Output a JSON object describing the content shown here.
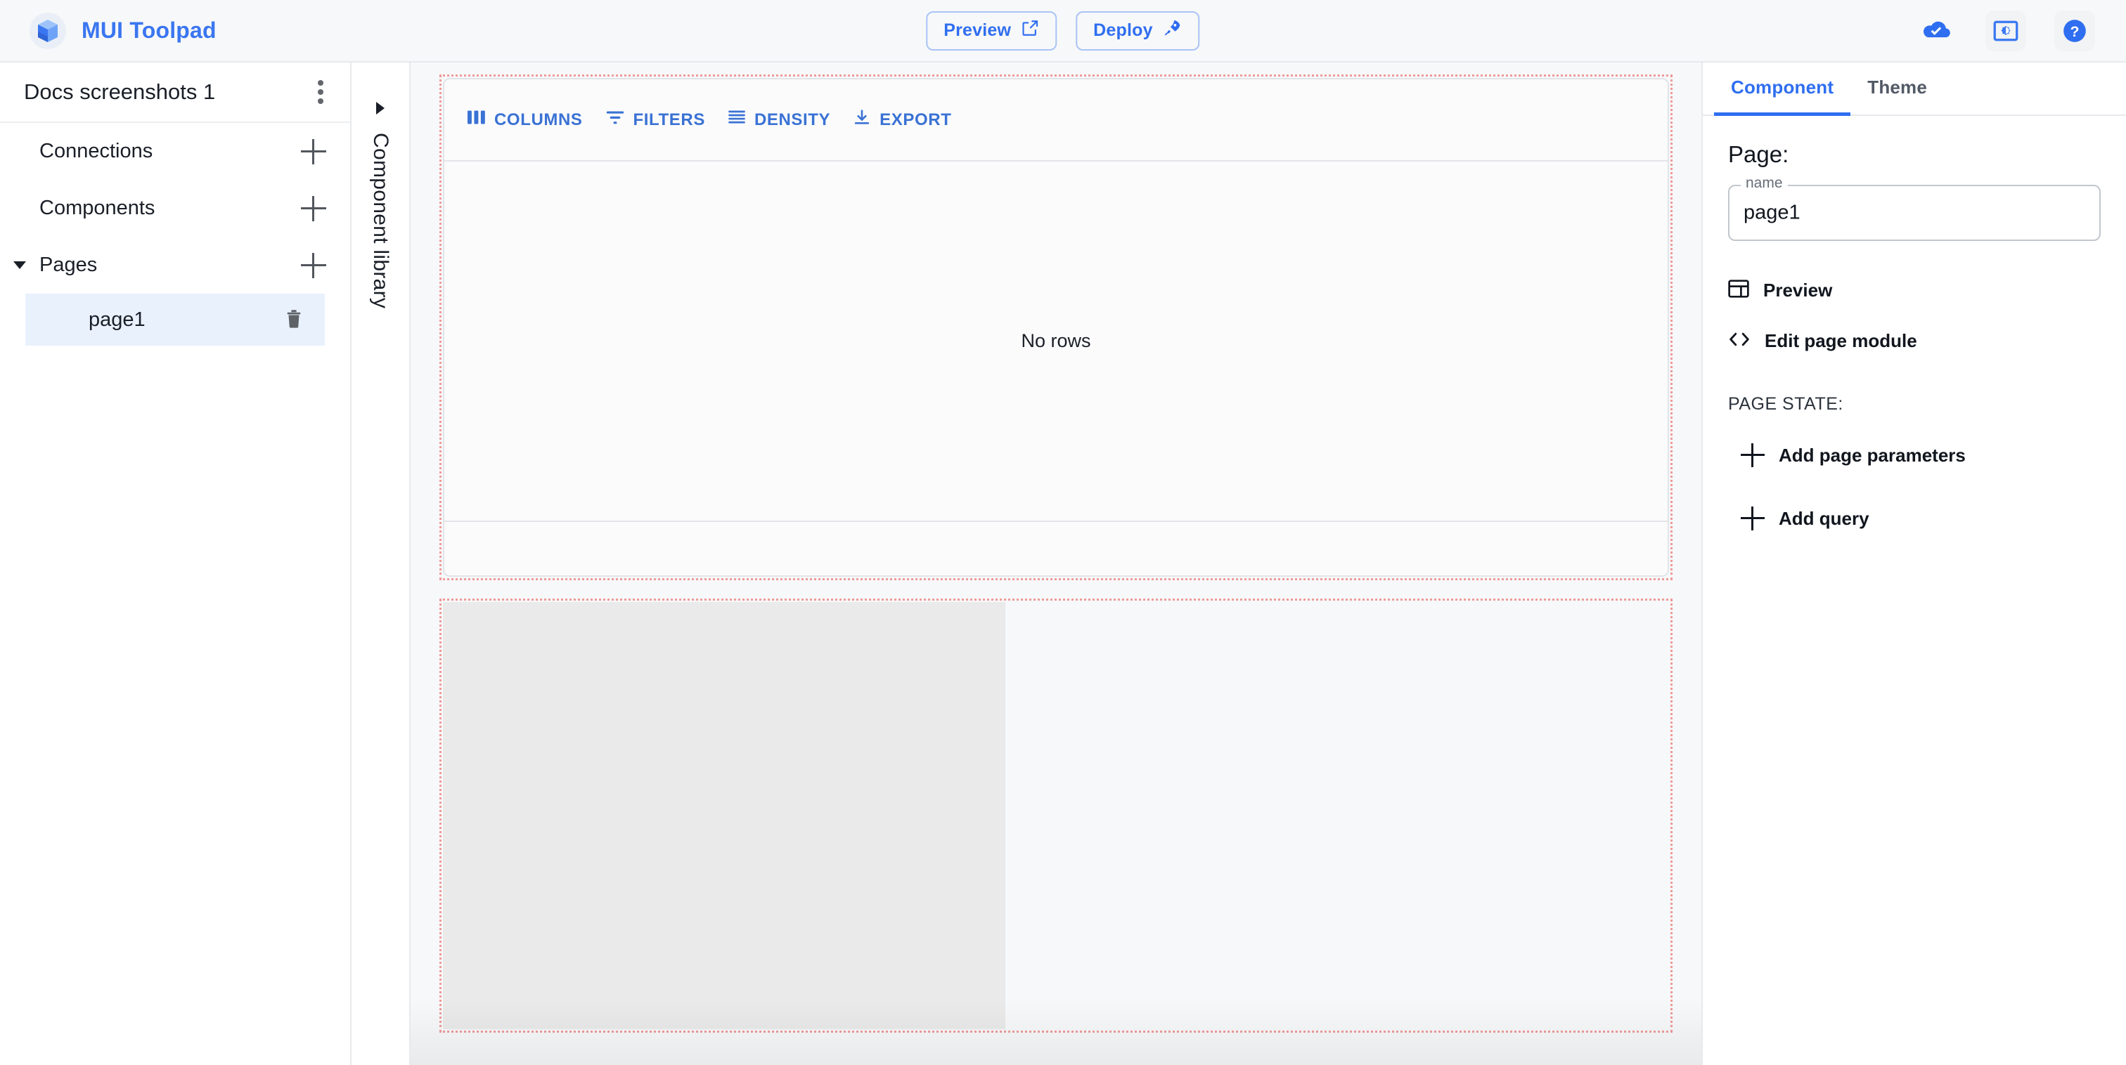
{
  "header": {
    "brand_title": "MUI Toolpad",
    "logo_icon": "toolpad-logo-icon",
    "preview_label": "Preview",
    "preview_icon": "open-in-new-icon",
    "deploy_label": "Deploy",
    "deploy_icon": "rocket-icon",
    "cloud_icon": "cloud-done-icon",
    "brightness_icon": "settings-brightness-icon",
    "help_icon": "help-circle-icon"
  },
  "sidebar": {
    "app_name": "Docs screenshots 1",
    "kebab_icon": "more-vertical-icon",
    "sections": [
      {
        "label": "Connections",
        "add_icon": "plus-icon",
        "expandable": false
      },
      {
        "label": "Components",
        "add_icon": "plus-icon",
        "expandable": false
      },
      {
        "label": "Pages",
        "add_icon": "plus-icon",
        "expandable": true,
        "caret_icon": "caret-down-icon"
      }
    ],
    "pages": [
      {
        "label": "page1",
        "selected": true,
        "delete_icon": "trash-icon"
      }
    ]
  },
  "rail": {
    "label": "Component library",
    "expand_icon": "caret-right-icon"
  },
  "canvas": {
    "datagrid": {
      "toolbar": [
        {
          "label": "COLUMNS",
          "icon": "columns-icon"
        },
        {
          "label": "FILTERS",
          "icon": "filter-icon"
        },
        {
          "label": "DENSITY",
          "icon": "density-icon"
        },
        {
          "label": "EXPORT",
          "icon": "download-icon"
        }
      ],
      "empty_message": "No rows"
    },
    "selection_outline_color": "#ef9a9a",
    "block_left_color": "#eaeaea",
    "block_right_color": "#f7f8f9"
  },
  "inspector": {
    "tabs": [
      {
        "label": "Component",
        "active": true
      },
      {
        "label": "Theme",
        "active": false
      }
    ],
    "section_title": "Page:",
    "name_field": {
      "legend": "name",
      "value": "page1"
    },
    "actions": [
      {
        "label": "Preview",
        "icon": "web-asset-icon"
      },
      {
        "label": "Edit page module",
        "icon": "code-brackets-icon"
      }
    ],
    "page_state_label": "PAGE STATE:",
    "state_actions": [
      {
        "label": "Add page parameters",
        "icon": "plus-icon"
      },
      {
        "label": "Add query",
        "icon": "plus-icon"
      }
    ]
  },
  "colors": {
    "accent": "#2f6ef0",
    "toolbar_link": "#3a72d4",
    "selected_row": "#e9f1fd",
    "canvas_bg": "#f7f8f9"
  }
}
